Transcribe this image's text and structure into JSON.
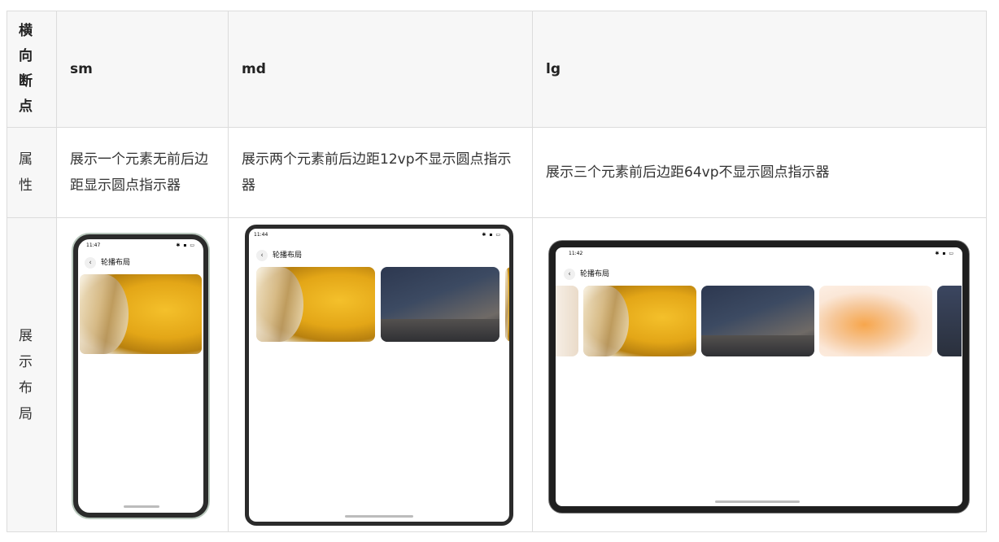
{
  "header": {
    "col0": "横向断点",
    "col1": "sm",
    "col2": "md",
    "col3": "lg"
  },
  "row_attr": {
    "label": "属性",
    "sm": "展示一个元素无前后边距显示圆点指示器",
    "md": "展示两个元素前后边距12vp不显示圆点指示器",
    "lg": "展示三个元素前后边距64vp不显示圆点指示器"
  },
  "row_layout": {
    "label": "展示布局",
    "sm_device": {
      "time": "11:47",
      "title": "轮播布局",
      "back": "‹"
    },
    "md_device": {
      "time": "11:44",
      "title": "轮播布局",
      "back": "‹"
    },
    "lg_device": {
      "time": "11:42",
      "title": "轮播布局",
      "back": "‹"
    }
  }
}
